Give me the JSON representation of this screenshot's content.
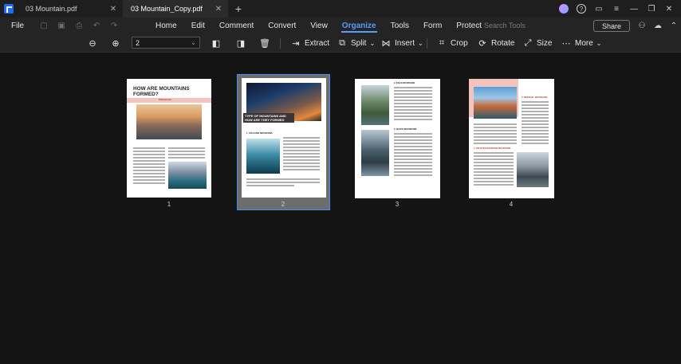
{
  "tabs": [
    {
      "title": "03 Mountain.pdf",
      "active": false
    },
    {
      "title": "03 Mountain_Copy.pdf",
      "active": true
    }
  ],
  "menu": {
    "file": "File",
    "items": [
      "Home",
      "Edit",
      "Comment",
      "Convert",
      "View",
      "Organize",
      "Tools",
      "Form",
      "Protect"
    ],
    "active": "Organize",
    "search_placeholder": "Search Tools",
    "share": "Share"
  },
  "toolbar": {
    "page_value": "2",
    "extract": "Extract",
    "split": "Split",
    "insert": "Insert",
    "crop": "Crop",
    "rotate": "Rotate",
    "size": "Size",
    "more": "More"
  },
  "pages": [
    {
      "number": "1",
      "title": "HOW ARE MOUNTAINS FORMED?",
      "subtitle": "PDFelement"
    },
    {
      "number": "2",
      "selected": true,
      "heading": "TYPE OF MOUNTAINS AND HOW ARE THEY FORMED",
      "section": "1. VOLCANIC MOUNTAINS"
    },
    {
      "number": "3",
      "section1": "2. FOLD MOUNTAINS",
      "section2": "3. BLOCK MOUNTAINS"
    },
    {
      "number": "4",
      "section1": "5. RESIDUAL MOUNTAINS",
      "section2": "4. UPLIFTED MOUNTAIN MOUNTAINS"
    }
  ],
  "colors": {
    "accent": "#5b9bff",
    "brand": "#1f6cf2",
    "selection": "#4a8cf7",
    "background": "#141414"
  }
}
